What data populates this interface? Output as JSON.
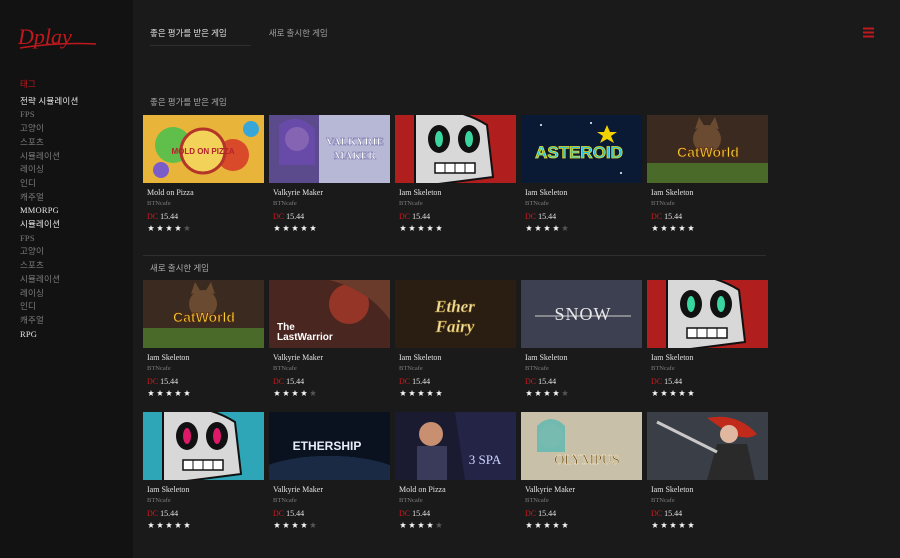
{
  "brand": {
    "logo_text": "Dplay",
    "accent": "#c0181c"
  },
  "sidebar": {
    "tag_label": "태그",
    "items": [
      {
        "label": "전략 시뮬레이션",
        "highlight": true
      },
      {
        "label": "FPS",
        "highlight": false
      },
      {
        "label": "고양이",
        "highlight": false
      },
      {
        "label": "스포츠",
        "highlight": false
      },
      {
        "label": "시뮬레이션",
        "highlight": false
      },
      {
        "label": "레이싱",
        "highlight": false
      },
      {
        "label": "인디",
        "highlight": false
      },
      {
        "label": "캐주얼",
        "highlight": false
      },
      {
        "label": "MMORPG",
        "highlight": true
      },
      {
        "label": "시뮬레이션",
        "highlight": true
      },
      {
        "label": "FPS",
        "highlight": false
      },
      {
        "label": "고양이",
        "highlight": false
      },
      {
        "label": "스포츠",
        "highlight": false
      },
      {
        "label": "시뮬레이션",
        "highlight": false
      },
      {
        "label": "레이싱",
        "highlight": false
      },
      {
        "label": "인디",
        "highlight": false
      },
      {
        "label": "캐주얼",
        "highlight": false
      },
      {
        "label": "RPG",
        "highlight": true
      }
    ]
  },
  "topnav": {
    "tabs": [
      {
        "label": "좋은 평가를 받은 게임",
        "active": true
      },
      {
        "label": "새로 출시한 게임",
        "active": false
      }
    ],
    "menu_icon": "hamburger-icon"
  },
  "sections": [
    {
      "title": "좋은 평가를 받은 게임",
      "rows": [
        [
          {
            "title": "Mold on Pizza",
            "dev": "BTNcafe",
            "currency": "DC",
            "price": "15.44",
            "rating": 4,
            "art": "mold",
            "art_text": "MOLD ON PIZZA"
          },
          {
            "title": "Valkyrie Maker",
            "dev": "BTNcafe",
            "currency": "DC",
            "price": "15.44",
            "rating": 5,
            "art": "valkyrie",
            "art_text": "VALKYRIE MAKER"
          },
          {
            "title": "Iam Skeleton",
            "dev": "BTNcafe",
            "currency": "DC",
            "price": "15.44",
            "rating": 5,
            "art": "skull-green",
            "art_text": ""
          },
          {
            "title": "Iam Skeleton",
            "dev": "BTNcafe",
            "currency": "DC",
            "price": "15.44",
            "rating": 4,
            "art": "asteroid",
            "art_text": "ASTEROID"
          },
          {
            "title": "Iam Skeleton",
            "dev": "BTNcafe",
            "currency": "DC",
            "price": "15.44",
            "rating": 5,
            "art": "catworld",
            "art_text": "CatWorld"
          }
        ]
      ]
    },
    {
      "title": "새로 출시한 게임",
      "rows": [
        [
          {
            "title": "Iam Skeleton",
            "dev": "BTNcafe",
            "currency": "DC",
            "price": "15.44",
            "rating": 5,
            "art": "catworld",
            "art_text": "CatWorld"
          },
          {
            "title": "Valkyrie Maker",
            "dev": "BTNcafe",
            "currency": "DC",
            "price": "15.44",
            "rating": 4,
            "art": "lastwarrior",
            "art_text": "The LastWarrior"
          },
          {
            "title": "Iam Skeleton",
            "dev": "BTNcafe",
            "currency": "DC",
            "price": "15.44",
            "rating": 5,
            "art": "etherfairy",
            "art_text": "Ether Fairy"
          },
          {
            "title": "Iam Skeleton",
            "dev": "BTNcafe",
            "currency": "DC",
            "price": "15.44",
            "rating": 4,
            "art": "snow",
            "art_text": "SNOW"
          },
          {
            "title": "Iam Skeleton",
            "dev": "BTNcafe",
            "currency": "DC",
            "price": "15.44",
            "rating": 5,
            "art": "skull-green",
            "art_text": ""
          }
        ],
        [
          {
            "title": "Iam Skeleton",
            "dev": "BTNcafe",
            "currency": "DC",
            "price": "15.44",
            "rating": 5,
            "art": "skull-pink",
            "art_text": ""
          },
          {
            "title": "Valkyrie Maker",
            "dev": "BTNcafe",
            "currency": "DC",
            "price": "15.44",
            "rating": 4,
            "art": "ethership",
            "art_text": "ETHERSHIP"
          },
          {
            "title": "Mold on Pizza",
            "dev": "BTNcafe",
            "currency": "DC",
            "price": "15.44",
            "rating": 4,
            "art": "3spa",
            "art_text": "3 SPA"
          },
          {
            "title": "Valkyrie Maker",
            "dev": "BTNcafe",
            "currency": "DC",
            "price": "15.44",
            "rating": 5,
            "art": "olympus",
            "art_text": "OLYMPUS"
          },
          {
            "title": "Iam Skeleton",
            "dev": "BTNcafe",
            "currency": "DC",
            "price": "15.44",
            "rating": 5,
            "art": "redhair",
            "art_text": ""
          }
        ]
      ]
    }
  ]
}
